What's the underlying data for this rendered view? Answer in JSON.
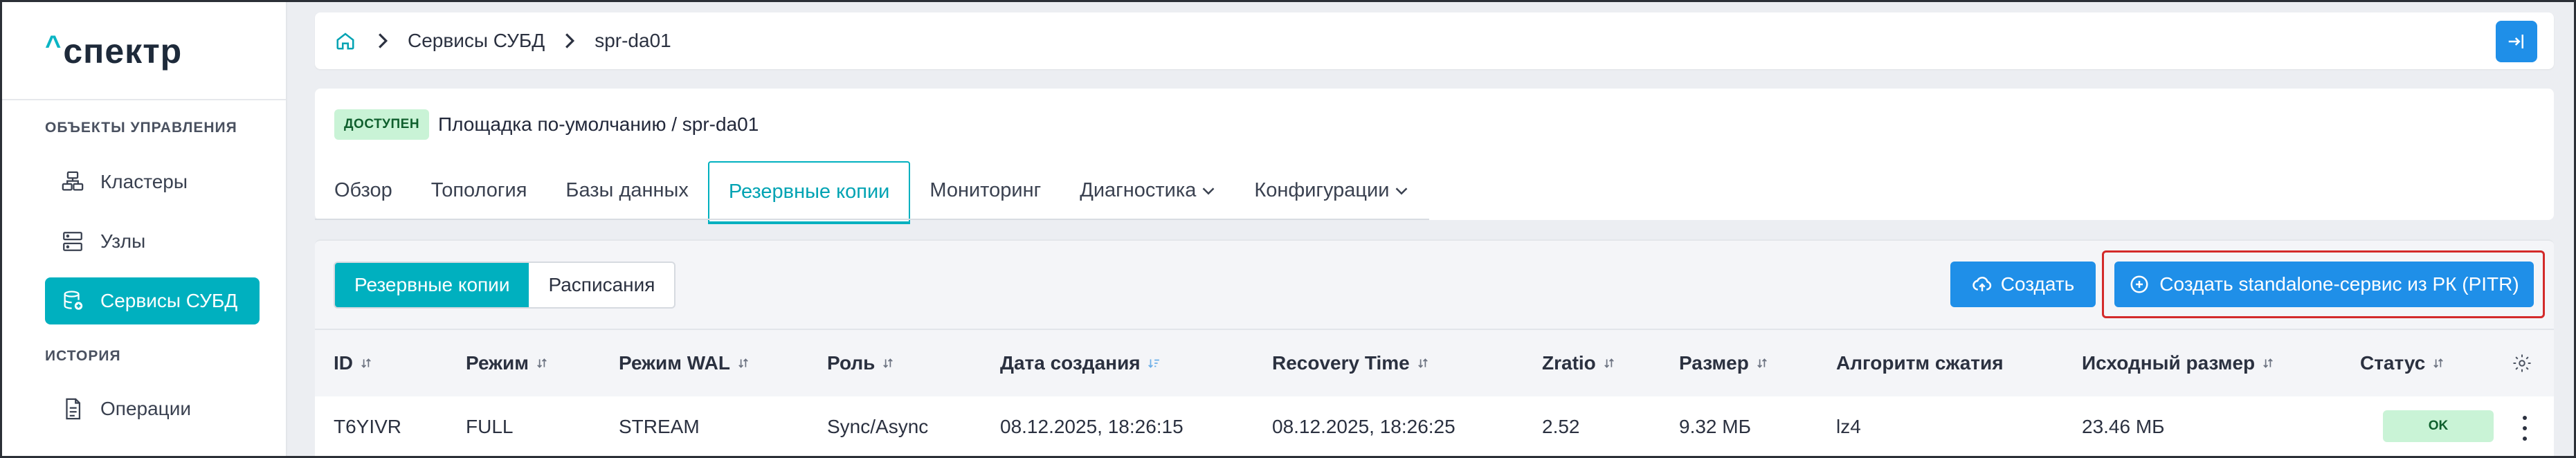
{
  "brand": {
    "logo_caret": "^",
    "logo_text": "спектр"
  },
  "sidebar": {
    "section_objects": "ОБЪЕКТЫ УПРАВЛЕНИЯ",
    "section_history": "ИСТОРИЯ",
    "items": [
      {
        "label": "Кластеры",
        "icon": "clusters-icon"
      },
      {
        "label": "Узлы",
        "icon": "nodes-icon"
      },
      {
        "label": "Сервисы СУБД",
        "icon": "db-services-icon",
        "active": true
      },
      {
        "label": "Операции",
        "icon": "operations-icon"
      }
    ]
  },
  "breadcrumb": {
    "home_icon": "home-icon",
    "level1": "Сервисы СУБД",
    "level2": "spr-da01"
  },
  "service": {
    "status": "ДОСТУПЕН",
    "path": "Площадка по-умолчанию /  spr-da01"
  },
  "tabs": [
    {
      "label": "Обзор"
    },
    {
      "label": "Топология"
    },
    {
      "label": "Базы данных"
    },
    {
      "label": "Резервные копии",
      "active": true
    },
    {
      "label": "Мониторинг"
    },
    {
      "label": "Диагностика",
      "dropdown": true
    },
    {
      "label": "Конфигурации",
      "dropdown": true
    }
  ],
  "backups": {
    "segments": [
      "Резервные копии",
      "Расписания"
    ],
    "create_label": "Создать",
    "pitr_label": "Создать standalone-сервис из РК (PITR)",
    "columns": [
      "ID",
      "Режим",
      "Режим WAL",
      "Роль",
      "Дата создания",
      "Recovery Time",
      "Zratio",
      "Размер",
      "Алгоритм сжатия",
      "Исходный размер",
      "Статус"
    ],
    "rows": [
      {
        "id": "T6YIVR",
        "mode": "FULL",
        "wal_mode": "STREAM",
        "role": "Sync/Async",
        "created": "08.12.2025, 18:26:15",
        "recovery_time": "08.12.2025, 18:26:25",
        "zratio": "2.52",
        "size": "9.32 МБ",
        "compression": "lz4",
        "orig_size": "23.46 МБ",
        "status": "OK"
      }
    ]
  },
  "colors": {
    "accent": "#00b0bf",
    "primary": "#1f8fe8",
    "ok_bg": "#c9f3d6",
    "highlight": "#d32a2a"
  }
}
